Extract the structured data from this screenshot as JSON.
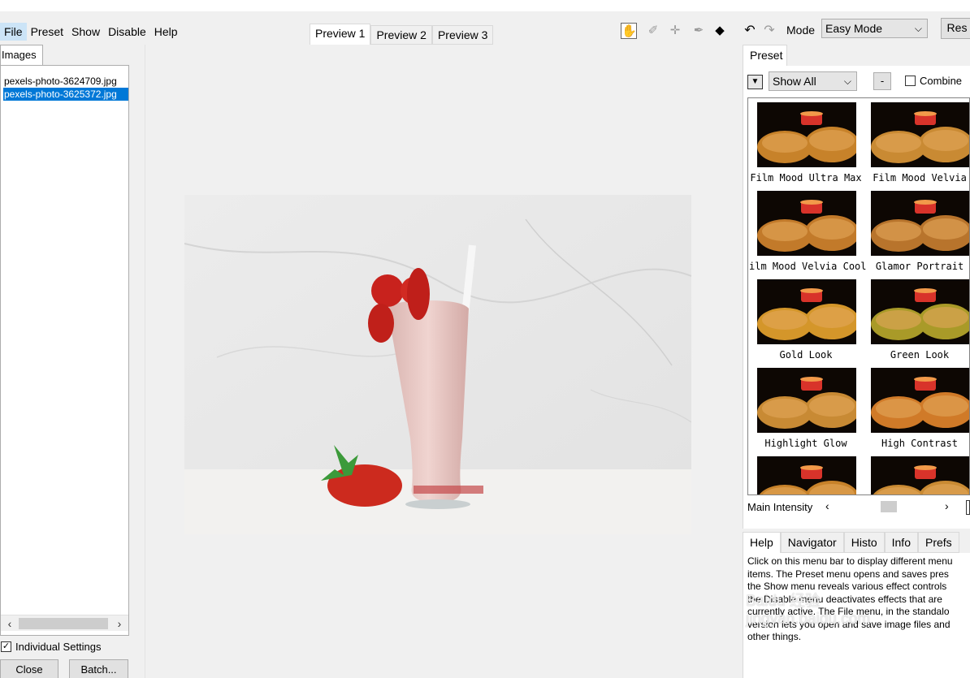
{
  "menu": {
    "items": [
      "File",
      "Preset",
      "Show",
      "Disable",
      "Help"
    ]
  },
  "left": {
    "tab_label": "Images",
    "files": [
      "pexels-photo-3624709.jpg",
      "pexels-photo-3625372.jpg"
    ],
    "selected_index": 1,
    "individual_settings_label": "Individual Settings",
    "individual_settings_checked": true,
    "close_label": "Close",
    "batch_label": "Batch..."
  },
  "preview": {
    "tabs": [
      "Preview 1",
      "Preview 2",
      "Preview 3"
    ],
    "active_index": 0
  },
  "toolbar": {
    "icons": [
      "hand-icon",
      "eyedropper-icon",
      "crosshair-icon",
      "brush-icon",
      "split-view-icon",
      "undo-icon",
      "redo-icon"
    ]
  },
  "mode": {
    "label": "Mode",
    "value": "Easy Mode",
    "reset_label": "Res"
  },
  "preset_panel": {
    "tab_label": "Preset",
    "filter_value": "Show All",
    "minus_label": "-",
    "combine_label": "Combine",
    "combine_checked": false,
    "presets": [
      "Film Mood Ultra Max",
      "Film Mood Velvia",
      "ilm Mood Velvia Cool",
      "Glamor Portrait",
      "Gold Look",
      "Green Look",
      "Highlight Glow",
      "High Contrast"
    ],
    "intensity_label": "Main Intensity"
  },
  "help_panel": {
    "tabs": [
      "Help",
      "Navigator",
      "Histo",
      "Info",
      "Prefs"
    ],
    "active_index": 0,
    "text": "Click on this menu bar to display different menu\nitems. The Preset menu opens and saves pres\nthe Show menu reveals various effect controls\nthe Disable menu deactivates effects that are\ncurrently active. The File menu, in the standalo\nversion lets you open and save image files and\nother things."
  },
  "watermark": "Baidu 经验\njingyan.baidu.com",
  "colors": {
    "selection": "#0078d7",
    "menu_hover": "#cce4f7",
    "panel": "#f0f0f0"
  }
}
